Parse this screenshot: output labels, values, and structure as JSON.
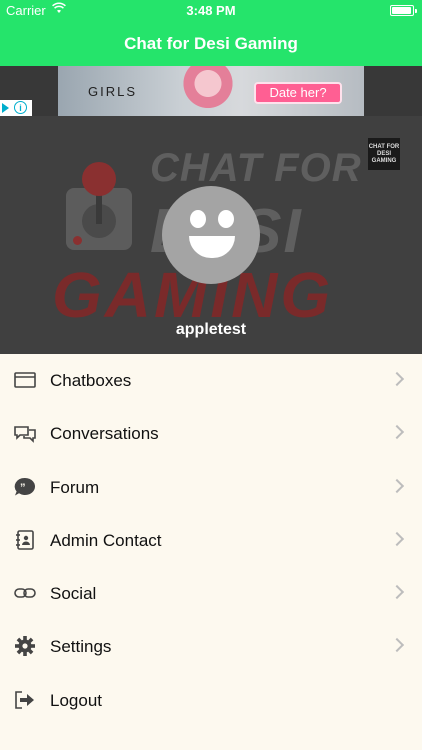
{
  "status_bar": {
    "carrier": "Carrier",
    "time": "3:48 PM",
    "battery_level_percent": 95
  },
  "nav": {
    "title": "Chat for Desi Gaming"
  },
  "ad": {
    "headline": "GIRLS",
    "cta": "Date her?",
    "info_glyph": "i"
  },
  "profile": {
    "logo_line1": "CHAT FOR",
    "logo_line2": "DESI",
    "logo_line3": "GAMING",
    "mini_logo": "CHAT FOR DESI GAMING",
    "username": "appletest"
  },
  "menu": {
    "items": [
      {
        "label": "Chatboxes",
        "icon": "chatbox-icon",
        "chevron": true
      },
      {
        "label": "Conversations",
        "icon": "conversations-icon",
        "chevron": true
      },
      {
        "label": "Forum",
        "icon": "forum-icon",
        "chevron": true
      },
      {
        "label": "Admin Contact",
        "icon": "contact-book-icon",
        "chevron": true
      },
      {
        "label": "Social",
        "icon": "link-icon",
        "chevron": true
      },
      {
        "label": "Settings",
        "icon": "gear-icon",
        "chevron": true
      },
      {
        "label": "Logout",
        "icon": "logout-icon",
        "chevron": false
      }
    ]
  },
  "colors": {
    "accent": "#25e46b",
    "header_bg": "#404040",
    "menu_bg": "#fdf9ef"
  }
}
